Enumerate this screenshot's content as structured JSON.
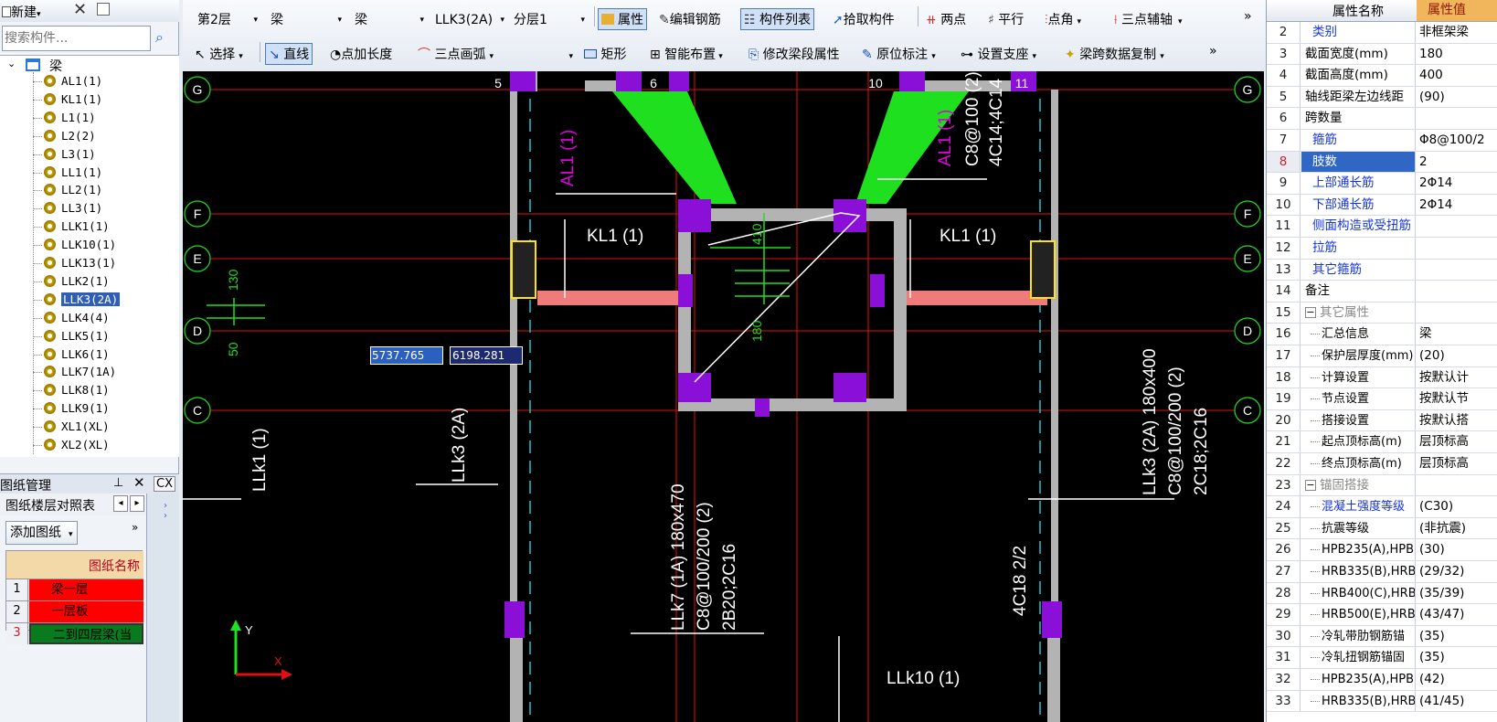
{
  "left_panel": {
    "new_label": "新建",
    "search_placeholder": "搜索构件...",
    "tree_root": "梁",
    "tree_items": [
      "AL1(1)",
      "KL1(1)",
      "L1(1)",
      "L2(2)",
      "L3(1)",
      "LL1(1)",
      "LL2(1)",
      "LL3(1)",
      "LLK1(1)",
      "LLK10(1)",
      "LLK13(1)",
      "LLK2(1)",
      "LLK3(2A)",
      "LLK4(4)",
      "LLK5(1)",
      "LLK6(1)",
      "LLK7(1A)",
      "LLK8(1)",
      "LLK9(1)",
      "XL1(XL)",
      "XL2(XL)"
    ],
    "selected_item": "LLK3(2A)",
    "drawing_mgmt_title": "图纸管理",
    "pin_icon": "pin-icon",
    "tab_floor_table": "图纸楼层对照表",
    "tab_cx": "CX",
    "add_drawing_label": "添加图纸",
    "drawing_table_header": "图纸名称",
    "drawings": [
      {
        "num": "1",
        "name": "梁一层",
        "color": "#ff0000"
      },
      {
        "num": "2",
        "name": "一层板",
        "color": "#ff0000"
      },
      {
        "num": "3",
        "name": "二到四层梁(当",
        "color": "#0a7a1e"
      }
    ]
  },
  "toolbar": {
    "row1": {
      "floor_select": "第2层",
      "category_select1": "梁",
      "category_select2": "梁",
      "component_select": "LLK3(2A)",
      "layer_select": "分层1",
      "btn_properties": "属性",
      "btn_edit_rebar": "编辑钢筋",
      "btn_component_list": "构件列表",
      "btn_pick_component": "拾取构件",
      "btn_two_points": "两点",
      "btn_parallel": "平行",
      "btn_point_angle": "点角",
      "btn_three_point_aux": "三点辅轴",
      "more": "»"
    },
    "row2": {
      "btn_select": "选择",
      "btn_line": "直线",
      "btn_point_length": "点加长度",
      "btn_three_point_arc": "三点画弧",
      "btn_rect": "矩形",
      "btn_smart_layout": "智能布置",
      "btn_modify_span": "修改梁段属性",
      "btn_in_place_label": "原位标注",
      "btn_set_support": "设置支座",
      "btn_copy_span_data": "梁跨数据复制",
      "more": "»"
    }
  },
  "canvas": {
    "axis_labels_rows": [
      "G",
      "F",
      "E",
      "D",
      "C"
    ],
    "axis_labels_cols": [
      "5",
      "6",
      "10",
      "11"
    ],
    "coord_input_x": "5737.765",
    "coord_input_y": "6198.281",
    "annotations": {
      "al1_left": "AL1 (1)",
      "al1_right": "AL1 (1)",
      "al1_right_a": "C8@100 (2)",
      "al1_right_b": "4C14;4C14",
      "kl1_left": "KL1 (1)",
      "kl1_right": "KL1 (1)",
      "dim_410": "410",
      "dim_180": "180",
      "dim_130": "130",
      "dim_50": "50",
      "llk1": "LLk1 (1)",
      "llk3_left": "LLk3 (2A)",
      "llk7_a": "LLk7 (1A)   180x470",
      "llk7_b": "C8@100/200 (2)",
      "llk7_c": "2B20;2C16",
      "llk3_right_a": "LLk3 (2A)   180x400",
      "llk3_right_b": "C8@100/200 (2)",
      "llk3_right_c": "2C18;2C16",
      "rebar_4c18": "4C18  2/2",
      "llk10": "LLk10 (1)"
    },
    "ucs_y": "Y",
    "ucs_x": "X"
  },
  "properties": {
    "header_name": "属性名称",
    "header_value": "属性值",
    "rows": [
      {
        "num": "2",
        "name": "类别",
        "value": "非框架梁",
        "style": "blue"
      },
      {
        "num": "3",
        "name": "截面宽度(mm)",
        "value": "180",
        "style": ""
      },
      {
        "num": "4",
        "name": "截面高度(mm)",
        "value": "400",
        "style": ""
      },
      {
        "num": "5",
        "name": "轴线距梁左边线距",
        "value": "(90)",
        "style": ""
      },
      {
        "num": "6",
        "name": "跨数量",
        "value": "",
        "style": ""
      },
      {
        "num": "7",
        "name": "箍筋",
        "value": "Φ8@100/2",
        "style": "blue"
      },
      {
        "num": "8",
        "name": "肢数",
        "value": "2",
        "style": "sel"
      },
      {
        "num": "9",
        "name": "上部通长筋",
        "value": "2Φ14",
        "style": "blue"
      },
      {
        "num": "10",
        "name": "下部通长筋",
        "value": "2Φ14",
        "style": "blue"
      },
      {
        "num": "11",
        "name": "侧面构造或受扭筋",
        "value": "",
        "style": "blue"
      },
      {
        "num": "12",
        "name": "拉筋",
        "value": "",
        "style": "blue"
      },
      {
        "num": "13",
        "name": "其它箍筋",
        "value": "",
        "style": "blue"
      },
      {
        "num": "14",
        "name": "备注",
        "value": "",
        "style": ""
      },
      {
        "num": "15",
        "name": "其它属性",
        "value": "",
        "style": "group"
      },
      {
        "num": "16",
        "name": "汇总信息",
        "value": "梁",
        "style": "sub"
      },
      {
        "num": "17",
        "name": "保护层厚度(mm)",
        "value": "(20)",
        "style": "sub"
      },
      {
        "num": "18",
        "name": "计算设置",
        "value": "按默认计",
        "style": "sub"
      },
      {
        "num": "19",
        "name": "节点设置",
        "value": "按默认节",
        "style": "sub"
      },
      {
        "num": "20",
        "name": "搭接设置",
        "value": "按默认搭",
        "style": "sub"
      },
      {
        "num": "21",
        "name": "起点顶标高(m)",
        "value": "层顶标高",
        "style": "sub"
      },
      {
        "num": "22",
        "name": "终点顶标高(m)",
        "value": "层顶标高",
        "style": "sub"
      },
      {
        "num": "23",
        "name": "锚固搭接",
        "value": "",
        "style": "group"
      },
      {
        "num": "24",
        "name": "混凝土强度等级",
        "value": "(C30)",
        "style": "subblue"
      },
      {
        "num": "25",
        "name": "抗震等级",
        "value": "(非抗震)",
        "style": "sub"
      },
      {
        "num": "26",
        "name": "HPB235(A),HPB3",
        "value": "(30)",
        "style": "sub"
      },
      {
        "num": "27",
        "name": "HRB335(B),HRB3",
        "value": "(29/32)",
        "style": "sub"
      },
      {
        "num": "28",
        "name": "HRB400(C),HRB4",
        "value": "(35/39)",
        "style": "sub"
      },
      {
        "num": "29",
        "name": "HRB500(E),HRB5",
        "value": "(43/47)",
        "style": "sub"
      },
      {
        "num": "30",
        "name": "冷轧带肋钢筋锚",
        "value": "(35)",
        "style": "sub"
      },
      {
        "num": "31",
        "name": "冷轧扭钢筋锚固",
        "value": "(35)",
        "style": "sub"
      },
      {
        "num": "32",
        "name": "HPB235(A),HPB3",
        "value": "(42)",
        "style": "sub"
      },
      {
        "num": "33",
        "name": "HRB335(B),HRB3",
        "value": "(41/45)",
        "style": "sub"
      }
    ]
  }
}
